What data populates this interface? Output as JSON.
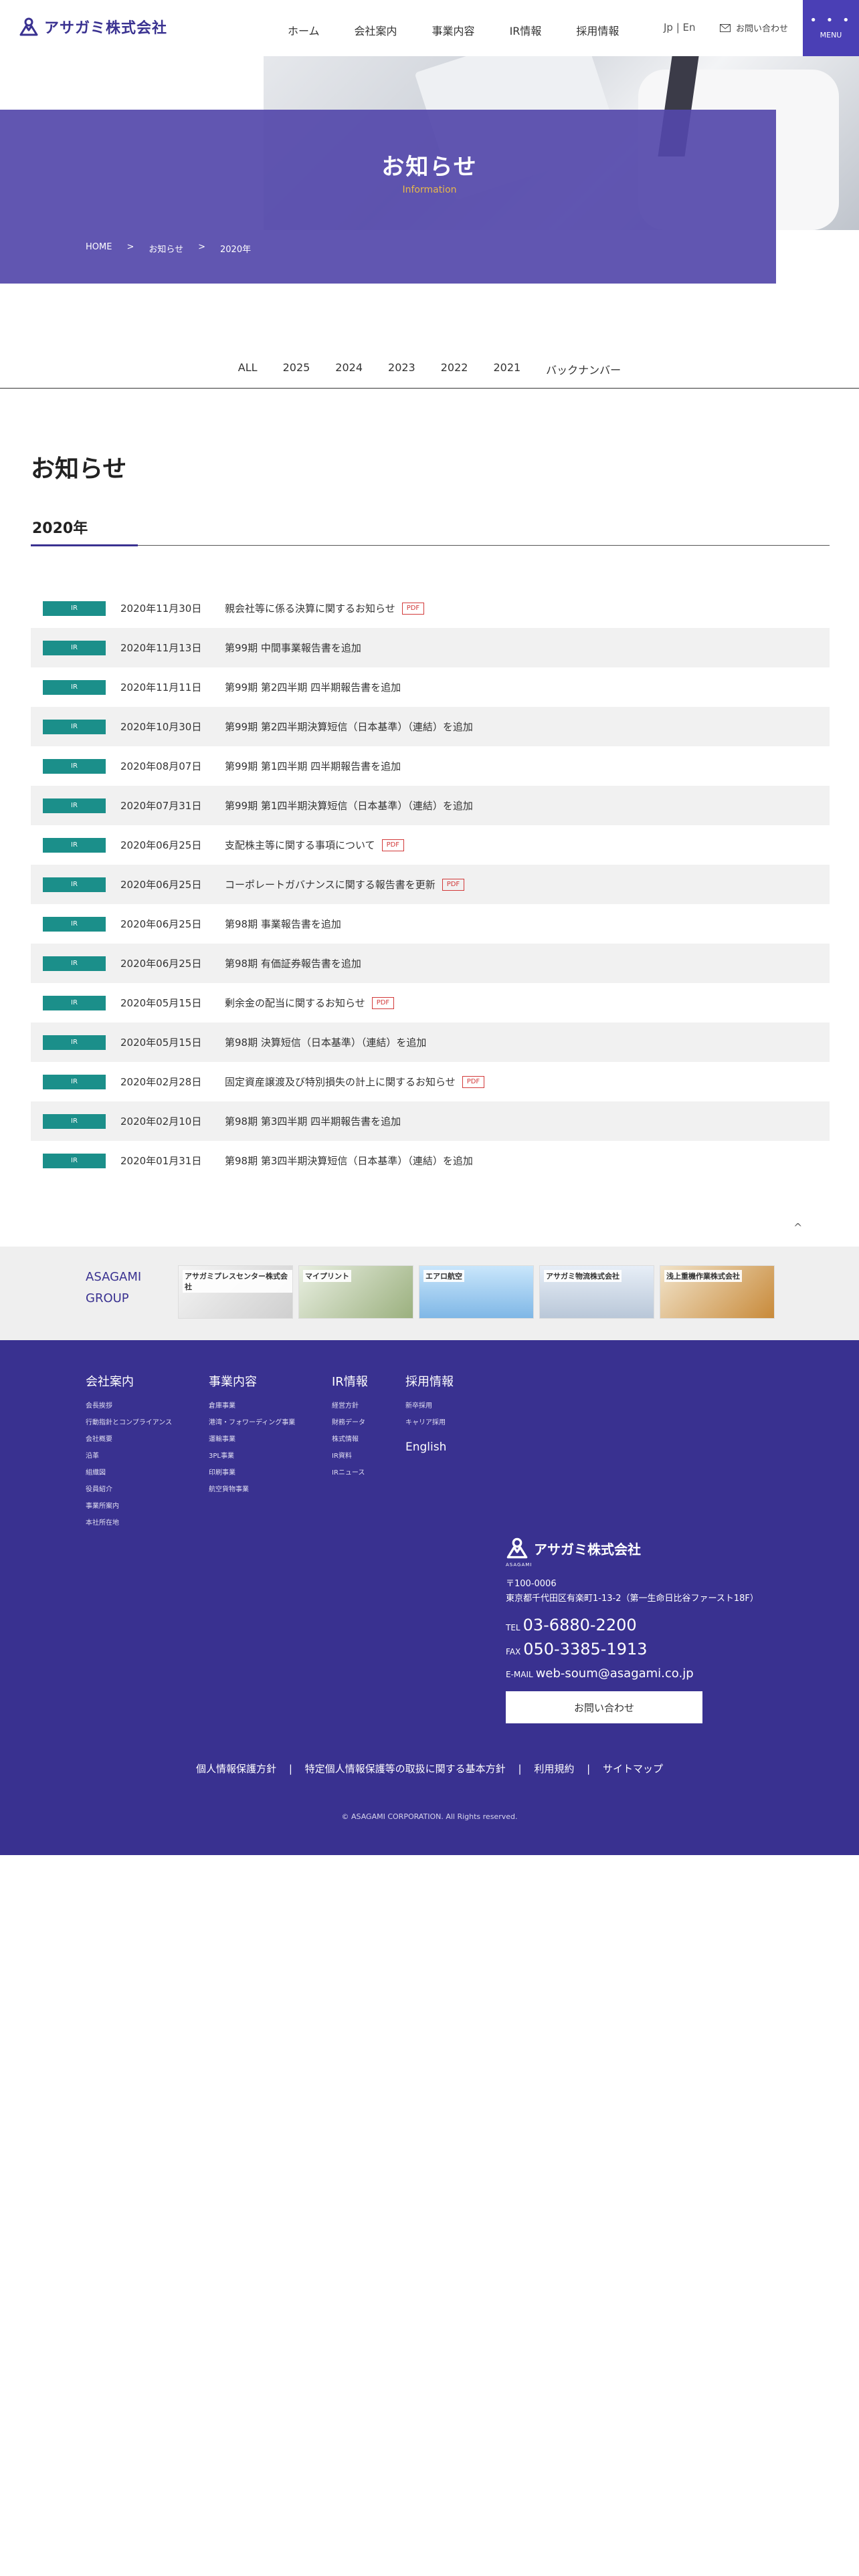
{
  "header": {
    "logo_text": "アサガミ株式会社",
    "nav": [
      "ホーム",
      "会社案内",
      "事業内容",
      "IR情報",
      "採用情報"
    ],
    "lang": "Jp | En",
    "contact": "お問い合わせ",
    "menu": "MENU"
  },
  "hero": {
    "title": "お知らせ",
    "subtitle": "Information",
    "breadcrumb": [
      "HOME",
      ">",
      "お知らせ",
      ">",
      "2020年"
    ]
  },
  "year_tabs": [
    "ALL",
    "2025",
    "2024",
    "2023",
    "2022",
    "2021",
    "バックナンバー"
  ],
  "section": {
    "title": "お知らせ",
    "year": "2020年"
  },
  "news": [
    {
      "cat": "IR",
      "date": "2020年11月30日",
      "title": "親会社等に係る決算に関するお知らせ",
      "pdf": "PDF"
    },
    {
      "cat": "IR",
      "date": "2020年11月13日",
      "title": "第99期 中間事業報告書を追加",
      "pdf": ""
    },
    {
      "cat": "IR",
      "date": "2020年11月11日",
      "title": "第99期 第2四半期 四半期報告書を追加",
      "pdf": ""
    },
    {
      "cat": "IR",
      "date": "2020年10月30日",
      "title": "第99期 第2四半期決算短信（日本基準）（連結）を追加",
      "pdf": ""
    },
    {
      "cat": "IR",
      "date": "2020年08月07日",
      "title": "第99期 第1四半期 四半期報告書を追加",
      "pdf": ""
    },
    {
      "cat": "IR",
      "date": "2020年07月31日",
      "title": "第99期 第1四半期決算短信（日本基準）（連結）を追加",
      "pdf": ""
    },
    {
      "cat": "IR",
      "date": "2020年06月25日",
      "title": "支配株主等に関する事項について",
      "pdf": "PDF"
    },
    {
      "cat": "IR",
      "date": "2020年06月25日",
      "title": "コーポレートガバナンスに関する報告書を更新",
      "pdf": "PDF"
    },
    {
      "cat": "IR",
      "date": "2020年06月25日",
      "title": "第98期 事業報告書を追加",
      "pdf": ""
    },
    {
      "cat": "IR",
      "date": "2020年06月25日",
      "title": "第98期 有価証券報告書を追加",
      "pdf": ""
    },
    {
      "cat": "IR",
      "date": "2020年05月15日",
      "title": "剰余金の配当に関するお知らせ",
      "pdf": "PDF"
    },
    {
      "cat": "IR",
      "date": "2020年05月15日",
      "title": "第98期 決算短信（日本基準）（連結）を追加",
      "pdf": ""
    },
    {
      "cat": "IR",
      "date": "2020年02月28日",
      "title": "固定資産譲渡及び特別損失の計上に関するお知らせ",
      "pdf": "PDF"
    },
    {
      "cat": "IR",
      "date": "2020年02月10日",
      "title": "第98期 第3四半期 四半期報告書を追加",
      "pdf": ""
    },
    {
      "cat": "IR",
      "date": "2020年01月31日",
      "title": "第98期 第3四半期決算短信（日本基準）（連結）を追加",
      "pdf": ""
    }
  ],
  "pagetop": "^",
  "group": {
    "label_1": "ASAGAMI",
    "label_2": "GROUP",
    "banners": [
      "アサガミプレスセンター株式会社",
      "マイプリント",
      "エアロ航空",
      "アサガミ物流株式会社",
      "浅上重機作業株式会社"
    ]
  },
  "footer": {
    "cols": [
      {
        "head": "会社案内",
        "items": [
          "会長挨拶",
          "行動指針とコンプライアンス",
          "会社概要",
          "沿革",
          "組織図",
          "役員紹介",
          "事業所案内",
          "本社所在地"
        ]
      },
      {
        "head": "事業内容",
        "items": [
          "倉庫事業",
          "港湾・フォワーディング事業",
          "運輸事業",
          "3PL事業",
          "印刷事業",
          "航空貨物事業"
        ]
      },
      {
        "head": "IR情報",
        "items": [
          "経営方針",
          "財務データ",
          "株式情報",
          "IR資料",
          "IRニュース"
        ]
      },
      {
        "head": "採用情報",
        "items": [
          "新卒採用",
          "キャリア採用"
        ]
      }
    ],
    "english": "English",
    "corp_name": "アサガミ株式会社",
    "corp_sub": "ASAGAMI",
    "zip": "〒100-0006",
    "address": "東京都千代田区有楽町1-13-2（第一生命日比谷ファースト18F）",
    "tel_label": "TEL",
    "tel": "03-6880-2200",
    "fax_label": "FAX",
    "fax": "050-3385-1913",
    "email_label": "E-MAIL",
    "email": "web-soum@asagami.co.jp",
    "contact_btn": "お問い合わせ",
    "policies": [
      "個人情報保護方針",
      "特定個人情報保護等の取扱に関する基本方針",
      "利用規約",
      "サイトマップ"
    ],
    "policy_sep": "|",
    "copyright": "© ASAGAMI CORPORATION. All Rights reserved."
  },
  "colors": {
    "brand": "#3a3291",
    "accent_teal": "#1b8f8a",
    "pdf_red": "#d23a3a",
    "footer_bg": "#393190"
  }
}
